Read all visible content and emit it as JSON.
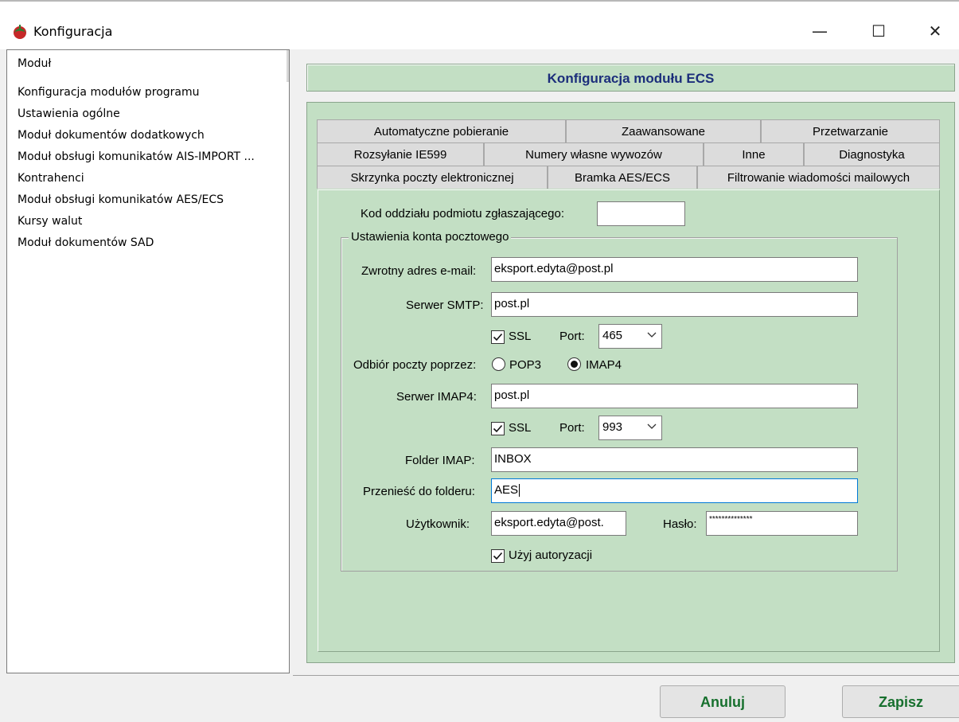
{
  "window": {
    "title": "Konfiguracja",
    "minimize_glyph": "—",
    "maximize_glyph": "☐",
    "close_glyph": "✕"
  },
  "tree": {
    "items": [
      "Moduł",
      "Konfiguracja modułów programu",
      "Ustawienia ogólne",
      "Moduł dokumentów dodatkowych",
      "Moduł obsługi komunikatów AIS-IMPORT ...",
      "Kontrahenci",
      "Moduł obsługi komunikatów AES/ECS",
      "Kursy walut",
      "Moduł dokumentów SAD"
    ]
  },
  "header": {
    "title": "Konfiguracja modułu ECS"
  },
  "tabs": {
    "row1": [
      "Automatyczne pobieranie",
      "Zaawansowane",
      "Przetwarzanie"
    ],
    "row2": [
      "Rozsyłanie IE599",
      "Numery własne wywozów",
      "Inne",
      "Diagnostyka"
    ],
    "row3": [
      "Skrzynka poczty elektronicznej",
      "Bramka AES/ECS",
      "Filtrowanie wiadomości mailowych"
    ],
    "active": "Skrzynka poczty elektronicznej"
  },
  "form": {
    "kod_label": "Kod oddziału podmiotu zgłaszającego:",
    "kod_value": "",
    "group_title": "Ustawienia konta pocztowego",
    "email_label": "Zwrotny adres e-mail:",
    "email_value": "eksport.edyta@post.pl",
    "smtp_label": "Serwer SMTP:",
    "smtp_value": "post.pl",
    "ssl_label": "SSL",
    "smtp_ssl_checked": true,
    "port_label": "Port:",
    "smtp_port": "465",
    "odbior_label": "Odbiór poczty poprzez:",
    "pop3_label": "POP3",
    "imap4_label": "IMAP4",
    "selected_protocol": "IMAP4",
    "imap_label": "Serwer IMAP4:",
    "imap_value": "post.pl",
    "imap_ssl_checked": true,
    "imap_port": "993",
    "folder_label": "Folder IMAP:",
    "folder_value": "INBOX",
    "przenies_label": "Przenieść do folderu:",
    "przenies_value": "AES",
    "user_label": "Użytkownik:",
    "user_value": "eksport.edyta@post.",
    "haslo_label": "Hasło:",
    "haslo_value": "**************",
    "auth_label": "Użyj autoryzacji",
    "auth_checked": true
  },
  "buttons": {
    "cancel": "Anuluj",
    "save": "Zapisz"
  },
  "colors": {
    "panel_green": "#c3dfc4",
    "header_text": "#1c2e7b",
    "button_text": "#17702e",
    "focus_border": "#0078d7"
  }
}
